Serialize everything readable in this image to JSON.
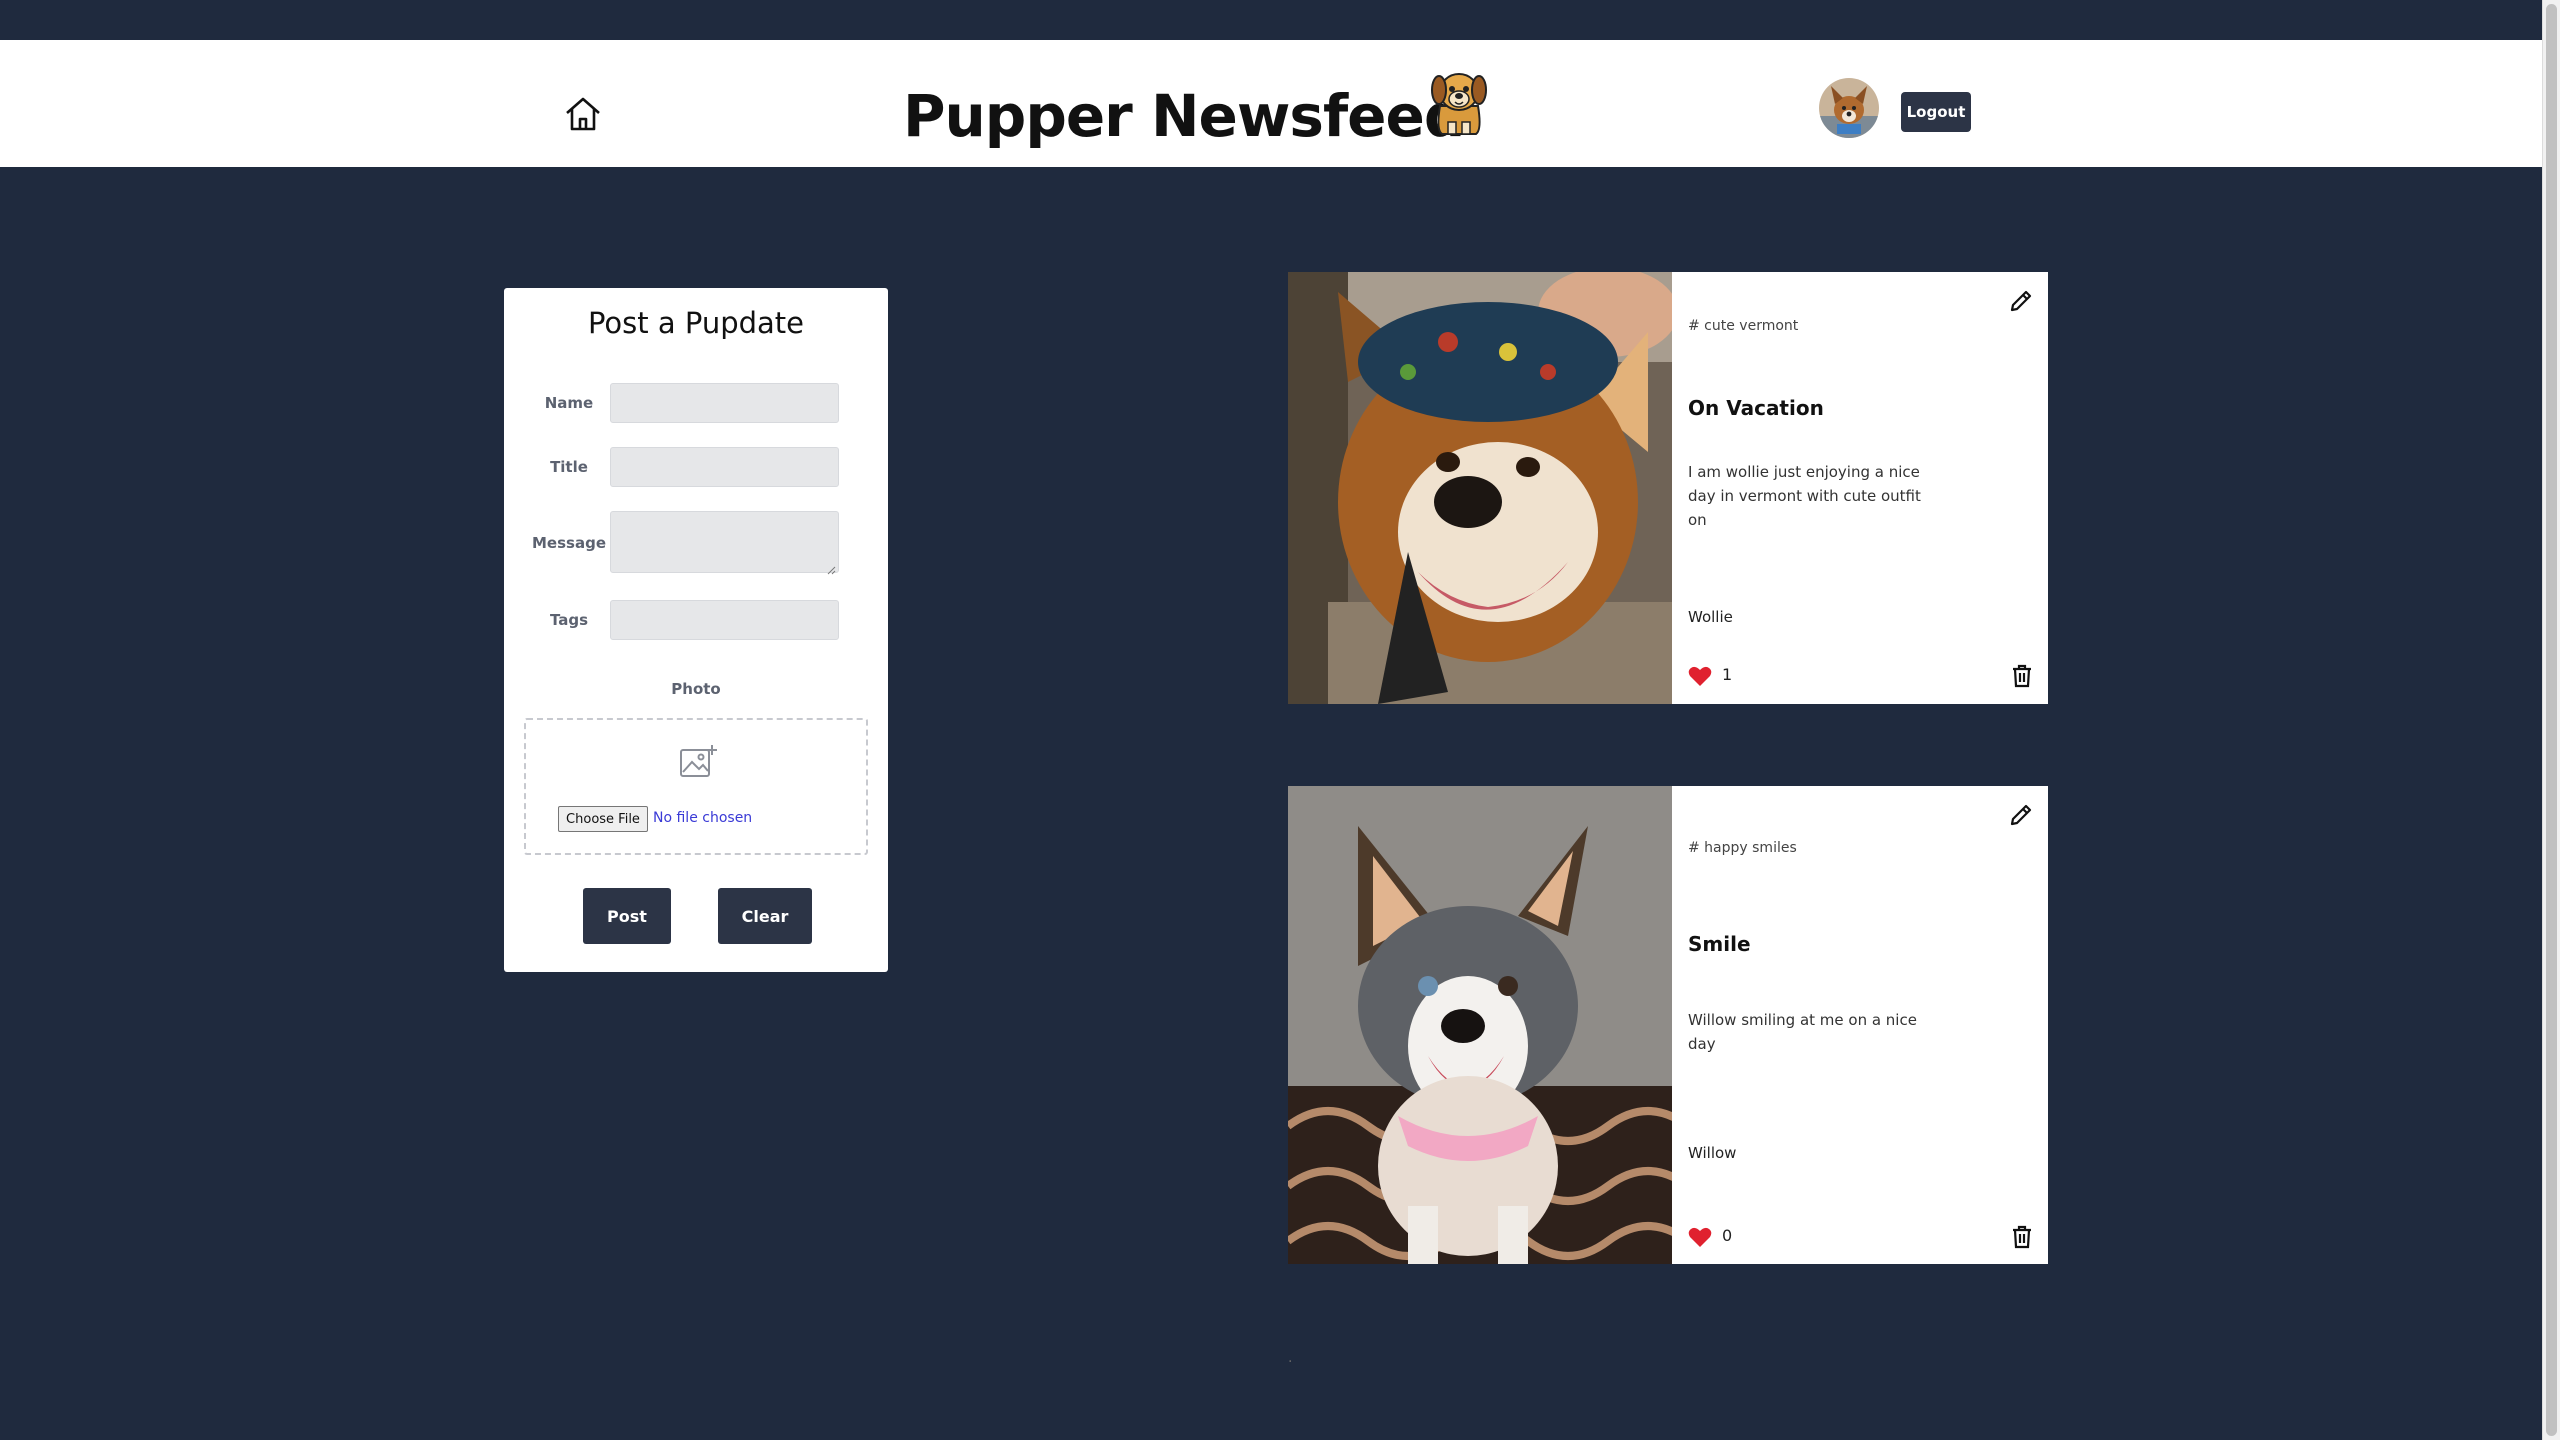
{
  "header": {
    "title": "Pupper Newsfeed",
    "logout_label": "Logout"
  },
  "form": {
    "heading": "Post a Pupdate",
    "name_label": "Name",
    "title_label": "Title",
    "message_label": "Message",
    "tags_label": "Tags",
    "photo_label": "Photo",
    "choose_file_label": "Choose File",
    "no_file_text": "No file chosen",
    "post_label": "Post",
    "clear_label": "Clear"
  },
  "posts": [
    {
      "tag": "# cute vermont",
      "title": "On Vacation",
      "message": "I am wollie just enjoying a nice day in vermont with cute outfit on",
      "author": "Wollie",
      "likes": "1"
    },
    {
      "tag": "# happy smiles",
      "title": "Smile",
      "message": "Willow smiling at me on a nice day",
      "author": "Willow",
      "likes": "0"
    }
  ],
  "footer": {
    "dot": "."
  },
  "colors": {
    "background": "#1f2a3e",
    "button": "#2c3446",
    "like": "#e0212f"
  },
  "icons": [
    "home-icon",
    "dog-logo-icon",
    "image-add-icon",
    "edit-icon",
    "heart-icon",
    "trash-icon"
  ]
}
